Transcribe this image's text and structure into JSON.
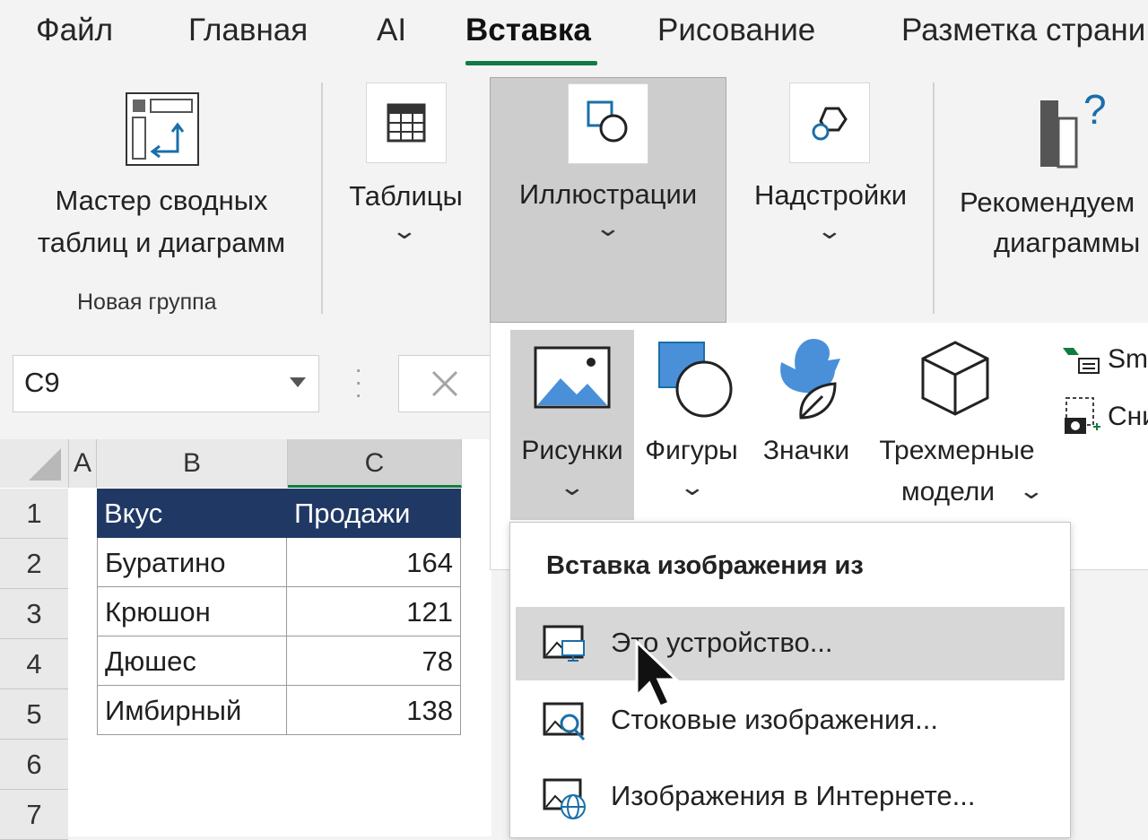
{
  "tabs": [
    {
      "label": "Файл"
    },
    {
      "label": "Главная"
    },
    {
      "label": "AI"
    },
    {
      "label": "Вставка"
    },
    {
      "label": "Рисование"
    },
    {
      "label": "Разметка страни"
    }
  ],
  "ribbon": {
    "pivot_wizard": {
      "line1": "Мастер сводных",
      "line2": "таблиц и диаграмм"
    },
    "new_group_label": "Новая группа",
    "tables": {
      "label": "Таблицы"
    },
    "illustrations": {
      "label": "Иллюстрации"
    },
    "addins": {
      "label": "Надстройки"
    },
    "recommended": {
      "line1": "Рекомендуем",
      "line2": "диаграммы"
    }
  },
  "formula_bar": {
    "name_box": "C9"
  },
  "sheet": {
    "columns": [
      "A",
      "B",
      "C"
    ],
    "rows": [
      "1",
      "2",
      "3",
      "4",
      "5",
      "6",
      "7"
    ],
    "table": {
      "headers": [
        "Вкус",
        "Продажи"
      ],
      "data": [
        [
          "Буратино",
          "164"
        ],
        [
          "Крюшон",
          "121"
        ],
        [
          "Дюшес",
          "78"
        ],
        [
          "Имбирный",
          "138"
        ]
      ]
    }
  },
  "gallery": {
    "pictures": "Рисунки",
    "shapes": "Фигуры",
    "icons": "Значки",
    "models_line1": "Трехмерные",
    "models_line2": "модели",
    "smartart": "Sm",
    "screenshot": "Сни"
  },
  "dropdown": {
    "title": "Вставка изображения из",
    "items": [
      {
        "label": "Это устройство..."
      },
      {
        "label": "Стоковые изображения..."
      },
      {
        "label": "Изображения в Интернете..."
      }
    ]
  },
  "colors": {
    "accent_green": "#107c41",
    "table_header": "#203864",
    "icon_blue": "#4a90d9"
  }
}
